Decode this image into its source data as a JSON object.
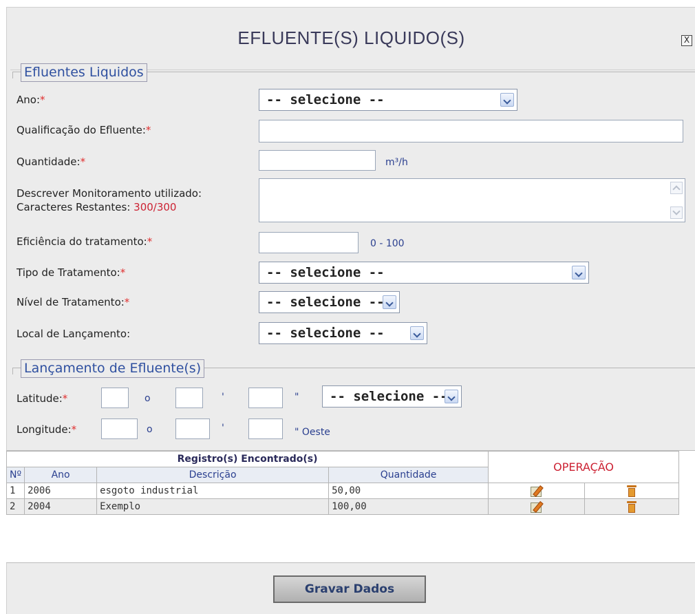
{
  "dialog": {
    "title": "EFLUENTE(S) LIQUIDO(S)",
    "close_label": "X"
  },
  "section_efluentes": {
    "legend": "Efluentes Liquidos",
    "fields": {
      "ano_label": "Ano:",
      "qualificacao_label": "Qualificação do Efluente:",
      "quantidade_label": "Quantidade:",
      "quantidade_unit": "m³/h",
      "monitoramento_label": "Descrever Monitoramento utilizado:",
      "caracteres_label": "Caracteres Restantes: ",
      "caracteres_value": "300/300",
      "eficiencia_label": "Eficiência do tratamento:",
      "eficiencia_range": "0 - 100",
      "tipo_label": "Tipo de Tratamento:",
      "nivel_label": "Nível de Tratamento:",
      "local_label": "Local de Lançamento:"
    },
    "required_mark": "*",
    "select_placeholder": "-- selecione --"
  },
  "section_lancamento": {
    "legend": "Lançamento de Efluente(s)",
    "latitude_label": "Latitude:",
    "longitude_label": "Longitude:",
    "degree_symbol": "o",
    "minute_symbol": "'",
    "second_symbol": "\"",
    "longitude_direction": "\" Oeste",
    "hemisphere_select": "-- selecione --"
  },
  "table": {
    "title": "Registro(s) Encontrado(s)",
    "operations_header": "OPERAÇÃO",
    "columns": [
      "Nº",
      "Ano",
      "Descrição",
      "Quantidade"
    ],
    "rows": [
      {
        "num": "1",
        "ano": "2006",
        "descricao": "esgoto industrial",
        "quantidade": "50,00"
      },
      {
        "num": "2",
        "ano": "2004",
        "descricao": "Exemplo",
        "quantidade": "100,00"
      }
    ]
  },
  "buttons": {
    "save_label": "Gravar Dados"
  },
  "colors": {
    "legend_text": "#2f50a0",
    "required": "#e03030",
    "operations": "#cc2233",
    "unit_text": "#2a3f8f"
  },
  "icons": {
    "close": "close-icon",
    "edit": "edit-icon",
    "delete": "trash-icon",
    "dropdown": "chevron-down-icon"
  }
}
